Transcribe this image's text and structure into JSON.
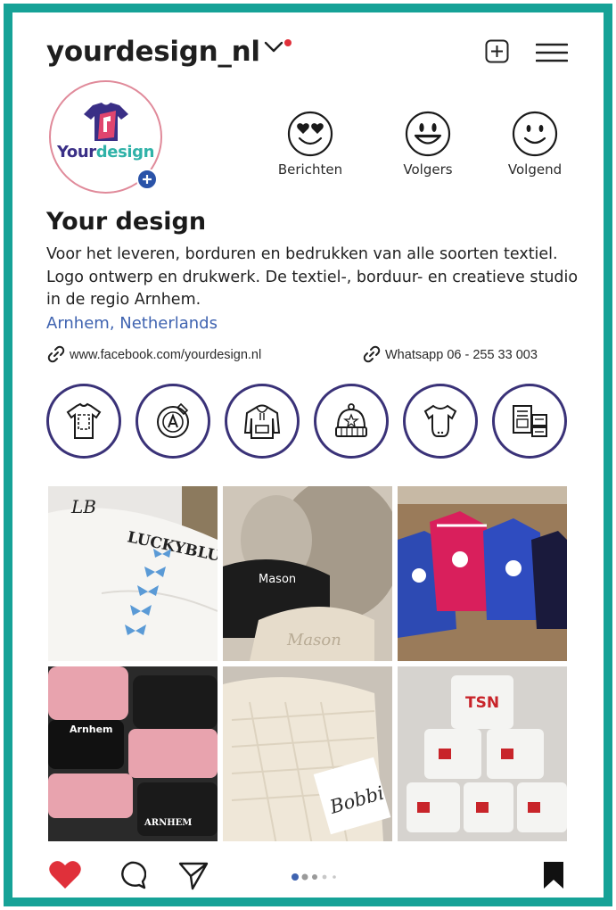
{
  "profile": {
    "handle": "yourdesign_nl",
    "avatar_text_part1": "Your",
    "avatar_text_part2": "design",
    "name": "Your design",
    "bio": "Voor het leveren, borduren en bedrukken van alle soorten textiel. Logo ontwerp en drukwerk. De textiel-, borduur- en creatieve studio in de regio Arnhem.",
    "location": "Arnhem, Netherlands",
    "website": "www.facebook.com/yourdesign.nl",
    "whatsapp": "Whatsapp 06 - 255 33 003"
  },
  "stats": [
    {
      "label": "Berichten",
      "icon": "heart-eyes-smiley-icon"
    },
    {
      "label": "Volgers",
      "icon": "grin-smiley-icon"
    },
    {
      "label": "Volgend",
      "icon": "smile-smiley-icon"
    }
  ],
  "highlights": [
    {
      "icon": "tshirt-print-icon"
    },
    {
      "icon": "logo-design-icon"
    },
    {
      "icon": "hoodie-icon"
    },
    {
      "icon": "beanie-icon"
    },
    {
      "icon": "baby-onesie-icon"
    },
    {
      "icon": "printed-matter-icon"
    }
  ],
  "posts": [
    {
      "text": "LUCKYBLU",
      "monogram": "LB"
    },
    {
      "text1": "Mason",
      "text2": "Mason"
    },
    {
      "text": ""
    },
    {
      "text": "Arnhem",
      "text2": "ARNHEM"
    },
    {
      "text": "Bobbi"
    },
    {
      "text": "TSN"
    }
  ],
  "pager": {
    "active": 0,
    "count": 5
  },
  "colors": {
    "frame": "#16a297",
    "accent_blue": "#3f63b0",
    "highlight_ring": "#3a3278",
    "like_red": "#e0303a"
  }
}
